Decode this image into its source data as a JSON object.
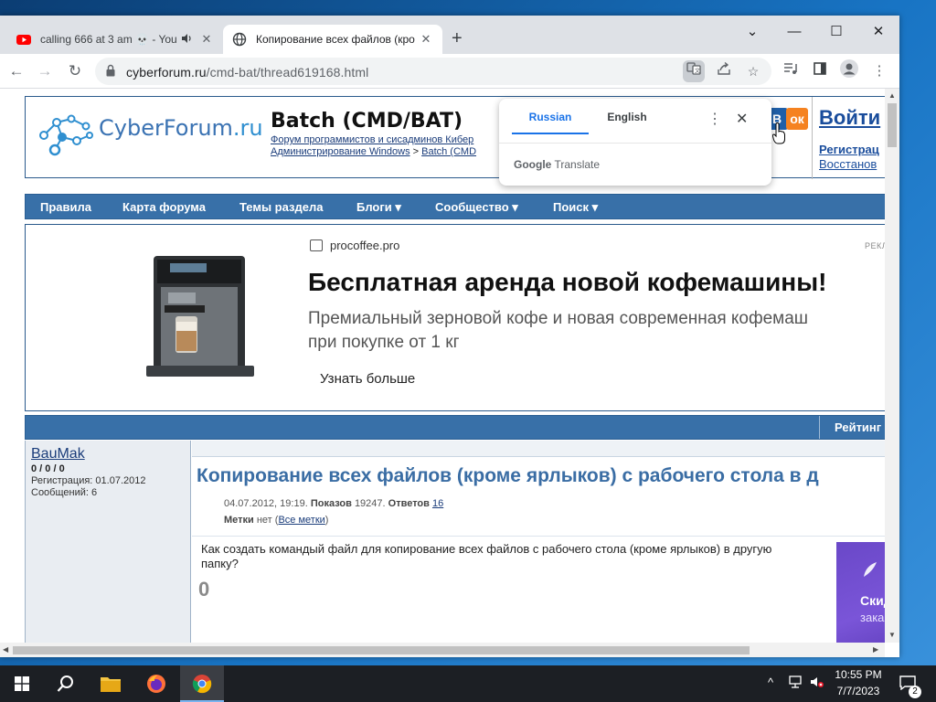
{
  "browser": {
    "tabs": [
      {
        "title": "calling 666 at 3 am 💀 - You",
        "icon": "youtube-icon",
        "audio": "speaker-icon"
      },
      {
        "title": "Копирование всех файлов (кро",
        "icon": "globe-icon"
      }
    ],
    "new_tab_label": "+",
    "window_controls": {
      "minimize": "—",
      "maximize": "☐",
      "close": "✕",
      "tab_search": "⌄"
    },
    "url": {
      "host": "cyberforum.ru",
      "path": "/cmd-bat/thread619168.html"
    }
  },
  "translate_popup": {
    "tab_source": "Russian",
    "tab_target": "English",
    "brand": "Google",
    "brand_suffix": "Translate",
    "menu_icon": "⋮",
    "close_icon": "✕"
  },
  "site": {
    "logo_text": "CyberForum",
    "logo_suffix": ".ru",
    "section_title": "Batch (CMD/BAT)",
    "crumb_line1": "Форум программистов и сисадминов Кибер",
    "crumb_root": "Администрирование Windows",
    "crumb_sep": " > ",
    "crumb_current": "Batch (CMD",
    "login": "Войти",
    "register": "Регистрац",
    "restore": "Восстанов",
    "nav": [
      "Правила",
      "Карта форума",
      "Темы раздела",
      "Блоги ▾",
      "Сообщество ▾",
      "Поиск ▾"
    ]
  },
  "ad": {
    "domain": "procoffee.pro",
    "label": "РЕКЛ",
    "headline": "Бесплатная аренда новой кофемашины!",
    "body_line1": "Премиальный зерновой кофе и новая современная кофемаш",
    "body_line2": "при покупке от 1 кг",
    "cta": "Узнать больше"
  },
  "thread": {
    "rating_label": "Рейтинг",
    "title": "Копирование всех файлов (кроме ярлыков) с рабочего стола в д",
    "date": "04.07.2012, 19:19.",
    "views_label": "Показов",
    "views": "19247.",
    "replies_label": "Ответов",
    "replies": "16",
    "tags_label": "Метки",
    "tags_value": "нет",
    "tags_link": "Все метки",
    "body": "Как создать командый файл для копирование всех файлов с рабочего стола (кроме ярлыков) в другую папку?",
    "vote": "0",
    "side_ad_line1": "Скид",
    "side_ad_line2": "зака"
  },
  "user": {
    "name": "BauMak",
    "score": "0 / 0 / 0",
    "registered": "Регистрация: 01.07.2012",
    "messages": "Сообщений: 6"
  },
  "taskbar": {
    "time": "10:55 PM",
    "date": "7/7/2023",
    "notifications": "2"
  },
  "colors": {
    "nav_bar": "#3870a8",
    "link": "#1a3c7a",
    "thread_title": "#3a6da4",
    "translate_accent": "#1a73e8"
  }
}
